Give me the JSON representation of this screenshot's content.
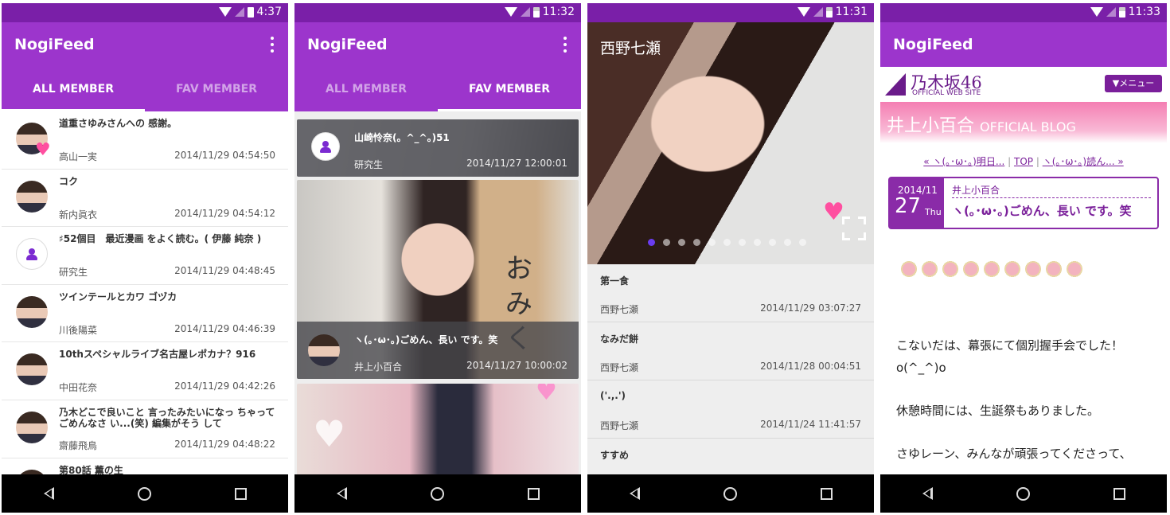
{
  "screen1": {
    "status_time": "4:37",
    "app_title": "NogiFeed",
    "tabs": [
      "ALL MEMBER",
      "FAV MEMBER"
    ],
    "items": [
      {
        "title": "道重さゆみさんへの 感謝。",
        "author": "高山一実",
        "date": "2014/11/29 04:54:50",
        "fav": true
      },
      {
        "title": "コク",
        "author": "新内眞衣",
        "date": "2014/11/29 04:54:12"
      },
      {
        "title": "♯52個目　最近漫画 をよく読む。( 伊藤 純奈 )",
        "author": "研究生",
        "date": "2014/11/29 04:48:45",
        "generic": true
      },
      {
        "title": "ツインテールとカワ ゴヅカ",
        "author": "川後陽菜",
        "date": "2014/11/29 04:46:39"
      },
      {
        "title": "10thスペシャルライブ名古屋レポカナ？916",
        "author": "中田花奈",
        "date": "2014/11/29 04:42:26"
      },
      {
        "title": "乃木どこで良いこと 言ったみたいになっ ちゃって ごめんなさ い...(笑) 編集がそう して",
        "author": "齋藤飛鳥",
        "date": "2014/11/29 04:48:22"
      },
      {
        "title": "第80話 薫の生",
        "author": "",
        "date": ""
      }
    ]
  },
  "screen2": {
    "status_time": "11:32",
    "app_title": "NogiFeed",
    "tabs": [
      "ALL MEMBER",
      "FAV MEMBER"
    ],
    "cards": [
      {
        "title": "山崎怜奈(。^_^。)51",
        "author": "研究生",
        "date": "2014/11/27 12:00:01"
      },
      {
        "title": "ヽ(｡･ω･｡)ごめん、長い です。笑",
        "author": "井上小百合",
        "date": "2014/11/27 10:00:02"
      }
    ],
    "photo_text": "おみく"
  },
  "screen3": {
    "status_time": "11:31",
    "photo_title": "西野七瀬",
    "items": [
      {
        "title": "第一食",
        "author": "西野七瀬",
        "date": "2014/11/29 03:07:27"
      },
      {
        "title": "なみだ餅",
        "author": "西野七瀬",
        "date": "2014/11/28 00:04:51"
      },
      {
        "title": "('.,.')",
        "author": "西野七瀬",
        "date": "2014/11/24 11:41:57"
      },
      {
        "title": "すすめ",
        "author": "",
        "date": ""
      }
    ]
  },
  "screen4": {
    "status_time": "11:33",
    "app_title": "NogiFeed",
    "logo_text": "乃木坂46",
    "logo_sub": "OFFICIAL WEB SITE",
    "menu_label": "▼メニュー",
    "blog_name": "井上小百合",
    "blog_name_suffix": "OFFICIAL BLOG",
    "nav_prev": "« ヽ(｡･ω･｡)明日...",
    "nav_top": "TOP",
    "nav_next": "ヽ(｡･ω･｡)読ん... »",
    "post_year_month": "2014/11",
    "post_day": "27",
    "post_weekday": "Thu",
    "post_author": "井上小百合",
    "post_title": "ヽ(｡･ω･｡)ごめん、長い です。笑",
    "body": [
      "こないだは、幕張にて個別握手会でした！",
      "o(^_^)o",
      "休憩時間には、生誕祭もありました。",
      "さゆレーン、みんなが頑張ってくださって、"
    ]
  }
}
